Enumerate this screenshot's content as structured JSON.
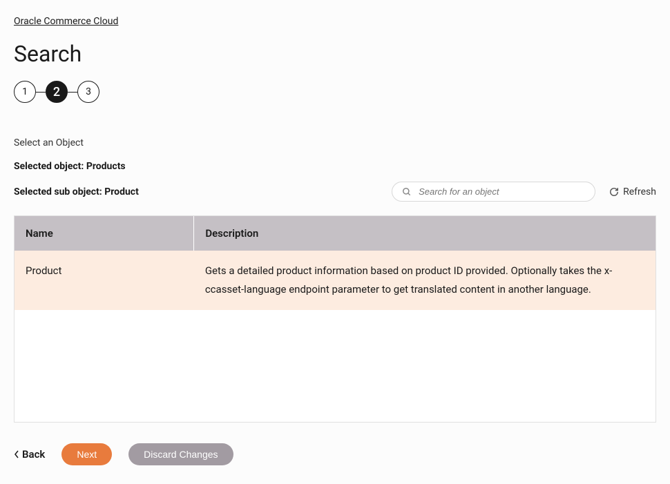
{
  "breadcrumb": "Oracle Commerce Cloud",
  "page_title": "Search",
  "stepper": {
    "steps": [
      "1",
      "2",
      "3"
    ],
    "active_index": 1
  },
  "section_label": "Select an Object",
  "selected_object_label": "Selected object: Products",
  "selected_sub_object_label": "Selected sub object: Product",
  "search": {
    "placeholder": "Search for an object"
  },
  "refresh_label": "Refresh",
  "table": {
    "headers": {
      "name": "Name",
      "description": "Description"
    },
    "rows": [
      {
        "name": "Product",
        "description": "Gets a detailed product information based on product ID provided. Optionally takes the x-ccasset-language endpoint parameter to get translated content in another language."
      }
    ]
  },
  "buttons": {
    "back": "Back",
    "next": "Next",
    "discard": "Discard Changes"
  }
}
